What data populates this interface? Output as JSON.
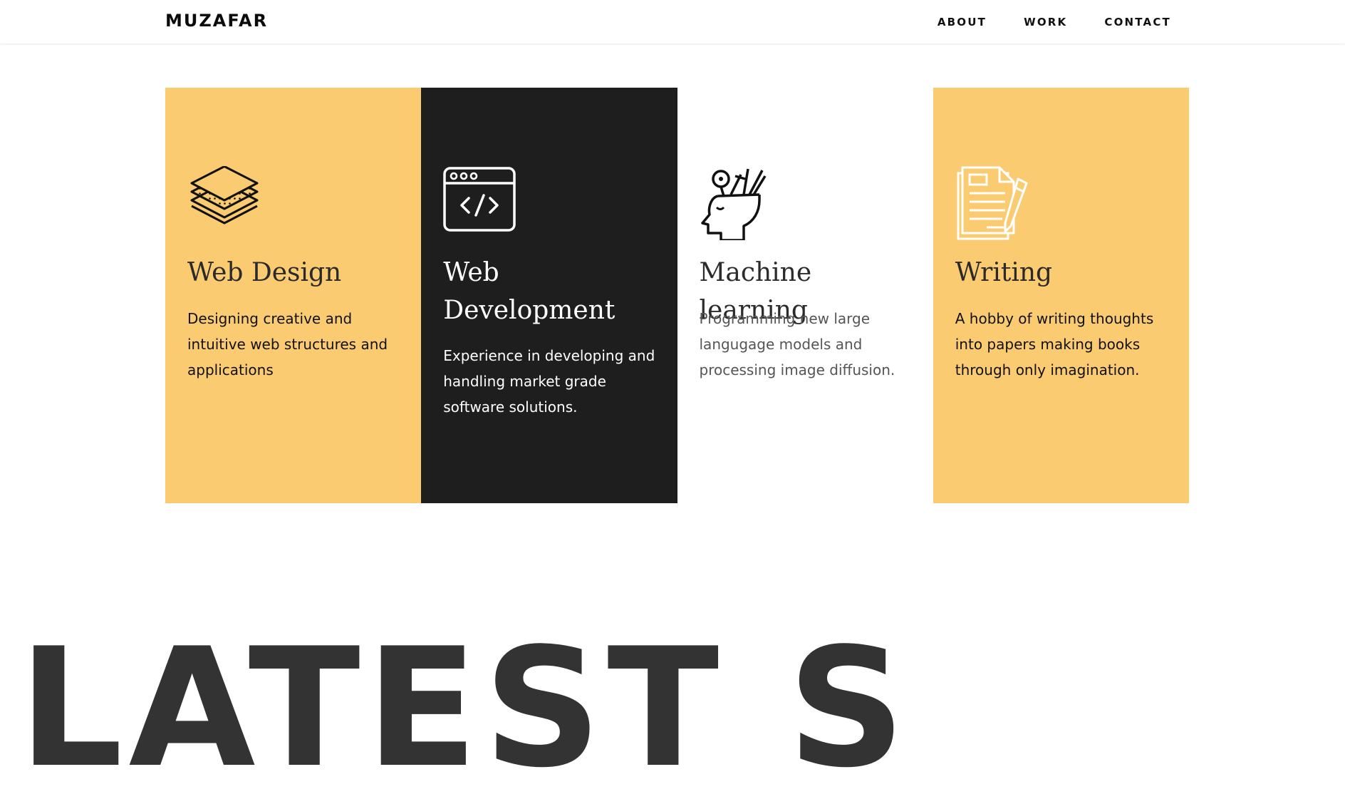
{
  "header": {
    "logo": "MUZAFAR",
    "nav": [
      "ABOUT",
      "WORK",
      "CONTACT"
    ]
  },
  "services": [
    {
      "title": "Web Design",
      "description": "Designing creative and intuitive web structures and applications",
      "icon": "layers-icon",
      "background": "#fbcb72"
    },
    {
      "title": "Web Development",
      "description": "Experience in developing and handling market grade software solutions.",
      "icon": "code-window-icon",
      "background": "#1e1e1e"
    },
    {
      "title": "Machine learning",
      "description": "Programming new large langugage models and processing image diffusion.",
      "icon": "head-ideas-icon",
      "background": "#ffffff"
    },
    {
      "title": "Writing",
      "description": "A hobby of writing thoughts into papers making books through only imagination.",
      "icon": "document-pen-icon",
      "background": "#fbcb72"
    }
  ],
  "latest_heading": "LATEST S",
  "colors": {
    "accent": "#fbcb72",
    "dark": "#1e1e1e",
    "heading": "#333333"
  }
}
